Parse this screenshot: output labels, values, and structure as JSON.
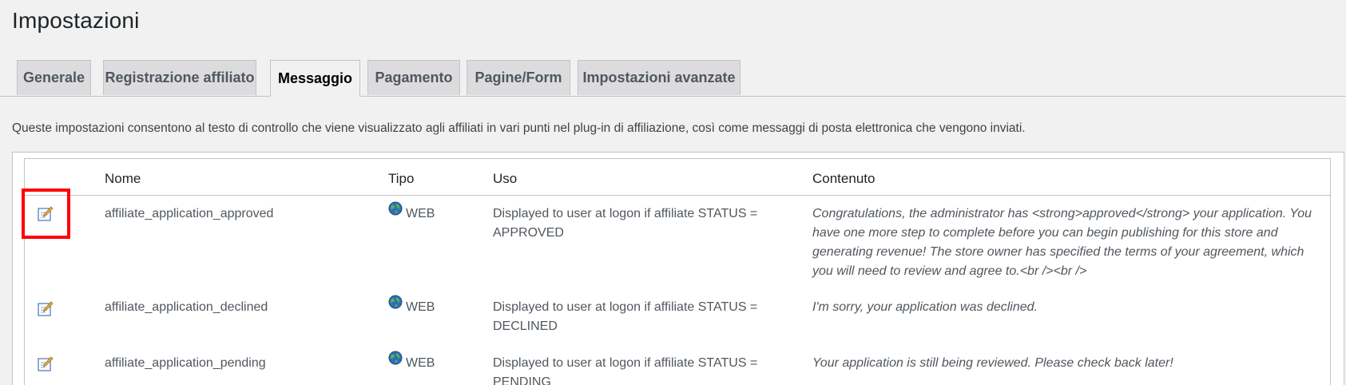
{
  "page": {
    "title": "Impostazioni"
  },
  "tabs": [
    {
      "label": "Generale",
      "active": false
    },
    {
      "label": "Registrazione affiliato",
      "active": false
    },
    {
      "label": "Messaggio",
      "active": true
    },
    {
      "label": "Pagamento",
      "active": false
    },
    {
      "label": "Pagine/Form",
      "active": false
    },
    {
      "label": "Impostazioni avanzate",
      "active": false
    }
  ],
  "description": "Queste impostazioni consentono al testo di controllo che viene visualizzato agli affiliati in vari punti nel plug-in di affiliazione, così come messaggi di posta elettronica che vengono inviati.",
  "table": {
    "headers": {
      "nome": "Nome",
      "tipo": "Tipo",
      "uso": "Uso",
      "contenuto": "Contenuto"
    },
    "rows": [
      {
        "edit_icon": "edit-pencil-icon",
        "name": "affiliate_application_approved",
        "type_icon": "globe-icon",
        "type": "WEB",
        "usage": "Displayed to user at logon if affiliate STATUS = APPROVED",
        "content": "Congratulations, the administrator has <strong>approved</strong> your application. You have one more step to complete before you can begin publishing for this store and generating revenue! The store owner has specified the terms of your agreement, which you will need to review and agree to.<br /><br />"
      },
      {
        "edit_icon": "edit-pencil-icon",
        "name": "affiliate_application_declined",
        "type_icon": "globe-icon",
        "type": "WEB",
        "usage": "Displayed to user at logon if affiliate STATUS = DECLINED",
        "content": "I'm sorry, your application was declined."
      },
      {
        "edit_icon": "edit-pencil-icon",
        "name": "affiliate_application_pending",
        "type_icon": "globe-icon",
        "type": "WEB",
        "usage": "Displayed to user at logon if affiliate STATUS = PENDING",
        "content": "Your application is still being reviewed. Please check back later!"
      }
    ]
  },
  "colors": {
    "background": "#f1f1f1",
    "highlight": "#ff0000",
    "border": "#c3c4c7"
  }
}
